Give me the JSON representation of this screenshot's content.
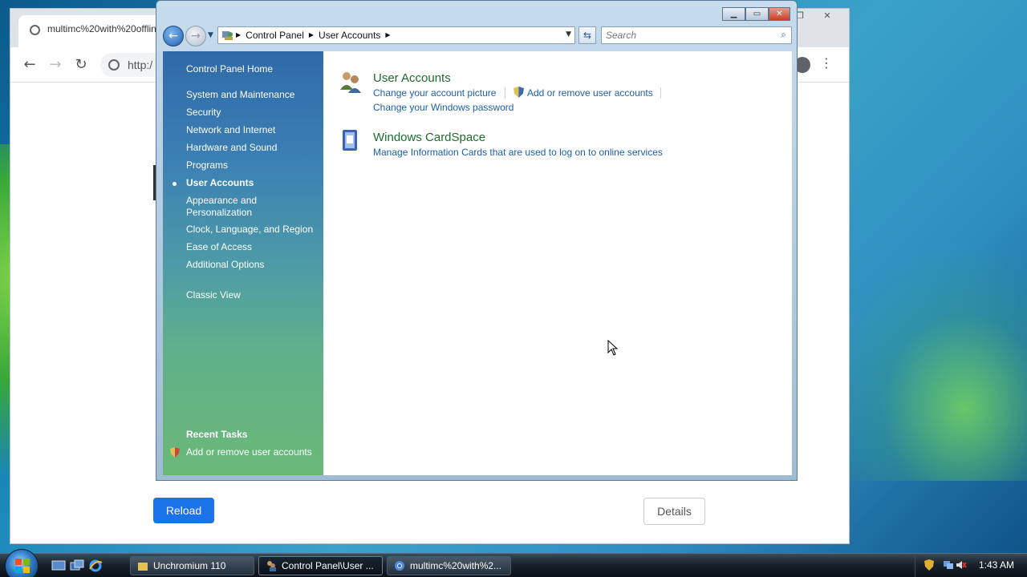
{
  "browser": {
    "tab_title": "multimc%20with%20offlin",
    "omnibox_text": "http:/",
    "reload_label": "Reload",
    "details_label": "Details"
  },
  "window": {
    "address": [
      "Control Panel",
      "User Accounts"
    ],
    "search_placeholder": "Search"
  },
  "sidebar": {
    "items": [
      {
        "label": "Control Panel Home"
      },
      {
        "label": "System and Maintenance"
      },
      {
        "label": "Security"
      },
      {
        "label": "Network and Internet"
      },
      {
        "label": "Hardware and Sound"
      },
      {
        "label": "Programs"
      },
      {
        "label": "User Accounts",
        "active": true
      },
      {
        "label": "Appearance and Personalization",
        "line1": "Appearance and",
        "line2": "Personalization"
      },
      {
        "label": "Clock, Language, and Region"
      },
      {
        "label": "Ease of Access"
      },
      {
        "label": "Additional Options"
      },
      {
        "label": "Classic View"
      }
    ],
    "recent_tasks_heading": "Recent Tasks",
    "recent_tasks": [
      "Add or remove user accounts"
    ]
  },
  "main": {
    "categories": [
      {
        "title": "User Accounts",
        "links": [
          "Change your account picture",
          "Add or remove user accounts",
          "Change your Windows password"
        ]
      },
      {
        "title": "Windows CardSpace",
        "links": [
          "Manage Information Cards that are used to log on to online services"
        ]
      }
    ]
  },
  "taskbar": {
    "buttons": [
      {
        "label": "Unchromium 110"
      },
      {
        "label": "Control Panel\\User ...",
        "active": true
      },
      {
        "label": "multimc%20with%2..."
      }
    ],
    "clock": "1:43 AM"
  },
  "colors": {
    "link": "#1e5fa8",
    "category_title": "#1e6b2e",
    "reload_button": "#1a73e8"
  }
}
